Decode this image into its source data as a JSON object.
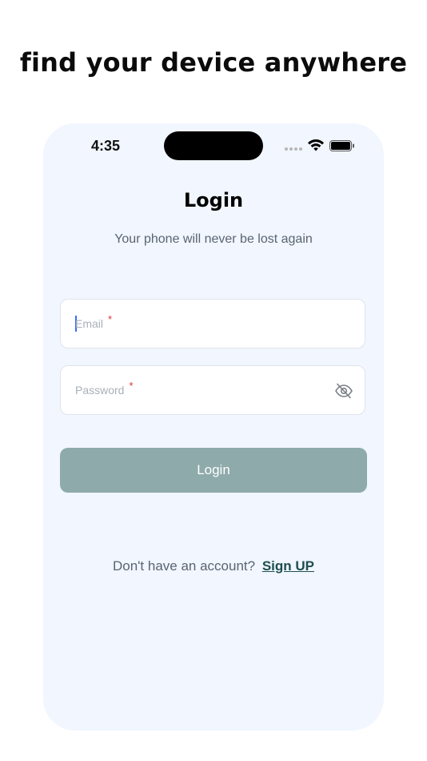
{
  "headline": "find your device anywhere",
  "status_bar": {
    "time": "4:35",
    "icons": [
      "signal-icon",
      "wifi-icon",
      "battery-icon"
    ]
  },
  "screen": {
    "title": "Login",
    "subtitle": "Your phone will never be lost again"
  },
  "form": {
    "email": {
      "placeholder": "Email",
      "required_mark": "*",
      "value": ""
    },
    "password": {
      "placeholder": "Password",
      "required_mark": "*",
      "value": "",
      "toggle_icon": "eye-off-icon"
    },
    "submit_label": "Login"
  },
  "footer": {
    "prompt": "Don't have an account?",
    "link_label": "Sign UP"
  },
  "colors": {
    "phone_bg": "#f1f6ff",
    "button_bg": "#8eaaab",
    "link": "#1f4e4e",
    "required": "#e0303a",
    "caret": "#3b6cf0"
  }
}
